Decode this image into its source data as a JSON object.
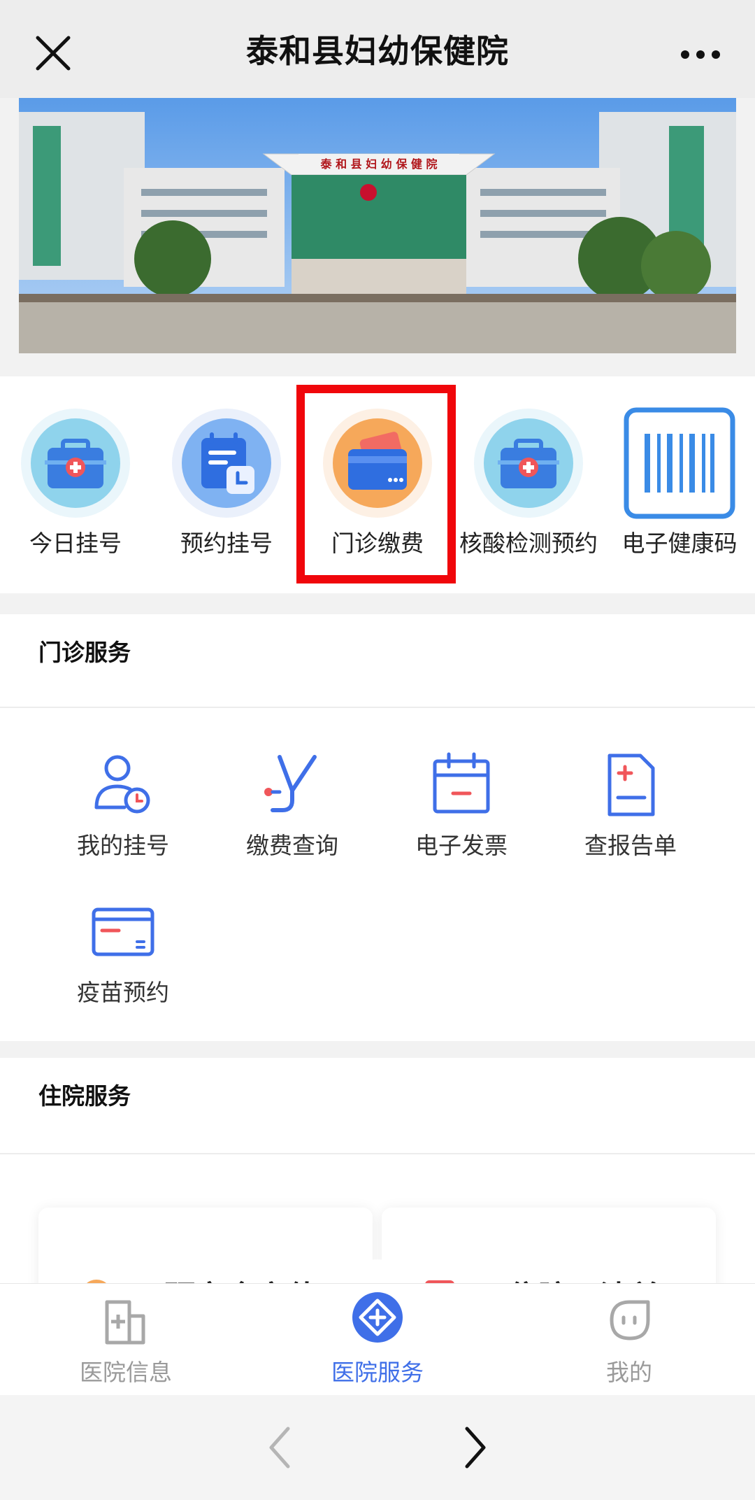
{
  "header": {
    "title": "泰和县妇幼保健院"
  },
  "banner": {
    "sign_text": "泰 和 县 妇 幼 保 健 院"
  },
  "quick_services": [
    {
      "label": "今日挂号",
      "icon": "medical-kit-icon"
    },
    {
      "label": "预约挂号",
      "icon": "calendar-clock-icon"
    },
    {
      "label": "门诊缴费",
      "icon": "wallet-card-icon"
    },
    {
      "label": "核酸检测预约",
      "icon": "medical-kit-icon"
    },
    {
      "label": "电子健康码",
      "icon": "barcode-icon"
    }
  ],
  "outpatient": {
    "title": "门诊服务",
    "items": [
      {
        "label": "我的挂号",
        "icon": "user-clock-icon"
      },
      {
        "label": "缴费查询",
        "icon": "stethoscope-icon"
      },
      {
        "label": "电子发票",
        "icon": "calendar-minus-icon"
      },
      {
        "label": "查报告单",
        "icon": "document-plus-icon"
      },
      {
        "label": "疫苗预约",
        "icon": "card-icon"
      }
    ]
  },
  "inpatient": {
    "title": "住院服务",
    "items": [
      {
        "label": "预交金充值"
      },
      {
        "label": "住院日清单"
      }
    ]
  },
  "tabbar": {
    "tabs": [
      {
        "label": "医院信息",
        "icon": "hospital-info-icon",
        "active": false
      },
      {
        "label": "医院服务",
        "icon": "hospital-service-icon",
        "active": true
      },
      {
        "label": "我的",
        "icon": "profile-icon",
        "active": false
      }
    ]
  },
  "colors": {
    "accent_blue": "#3f6fe8",
    "highlight_red": "#f0060b",
    "orange": "#f59a3a"
  }
}
